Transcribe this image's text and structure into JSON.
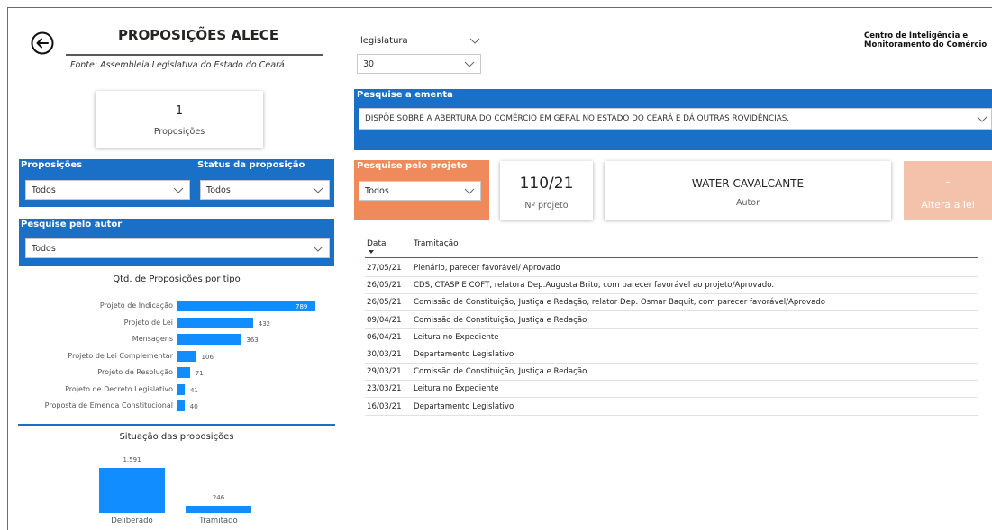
{
  "header": {
    "title": "PROPOSIÇÕES ALECE",
    "source": "Fonte: Assembleia Legislativa do Estado do Ceará"
  },
  "brand": {
    "line1": "Centro de Inteligência e",
    "line2": "Monitoramento do Comércio"
  },
  "count_card": {
    "value": "1",
    "label": "Proposições"
  },
  "filters": {
    "proposicoes": {
      "label": "Proposições",
      "value": "Todos"
    },
    "status": {
      "label": "Status da proposição",
      "value": "Todos"
    },
    "autor": {
      "label": "Pesquise pelo autor",
      "value": "Todos"
    },
    "legislatura": {
      "label": "legislatura",
      "value": "30"
    },
    "ementa": {
      "label": "Pesquise a ementa",
      "value": "DISPÕE SOBRE A ABERTURA DO COMÉRCIO EM GERAL NO ESTADO DO CEARÁ E DÁ OUTRAS ROVIDÊNCIAS."
    },
    "projeto": {
      "label": "Pesquise pelo projeto",
      "value": "Todos"
    }
  },
  "cards": {
    "projeto": {
      "value": "110/21",
      "label": "Nº projeto"
    },
    "autor": {
      "value": "WATER CAVALCANTE",
      "label": "Autor"
    },
    "altera": {
      "value": "-",
      "label": "Altera a lei"
    }
  },
  "chart_data": [
    {
      "type": "bar",
      "orientation": "horizontal",
      "title": "Qtd. de Proposições por tipo",
      "categories": [
        "Projeto de Indicação",
        "Projeto de Lei",
        "Mensagens",
        "Projeto de Lei Complementar",
        "Projeto de Resolução",
        "Projeto de Decreto Legislativo",
        "Proposta de Emenda Constitucional"
      ],
      "values": [
        789,
        432,
        363,
        106,
        71,
        41,
        40
      ],
      "value_labels": [
        "789",
        "432",
        "363",
        "106",
        "71",
        "41",
        "40"
      ],
      "color": "#118dff"
    },
    {
      "type": "bar",
      "title": "Situação das proposições",
      "categories": [
        "Deliberado",
        "Tramitado"
      ],
      "values": [
        1591,
        246
      ],
      "value_labels": [
        "1.591",
        "246"
      ],
      "color": "#118dff"
    }
  ],
  "table": {
    "headers": {
      "date": "Data",
      "text": "Tramitação"
    },
    "rows": [
      {
        "date": "27/05/21",
        "text": "Plenário, parecer favorável/ Aprovado"
      },
      {
        "date": "26/05/21",
        "text": "CDS, CTASP E COFT, relatora Dep.Augusta Brito, com parecer favorável ao projeto/Aprovado."
      },
      {
        "date": "26/05/21",
        "text": "Comissão de Constituição, Justiça e Redação, relator Dep. Osmar Baquit, com parecer favorável/Aprovado"
      },
      {
        "date": "09/04/21",
        "text": "Comissão de Constituição, Justiça e Redação"
      },
      {
        "date": "06/04/21",
        "text": "Leitura no Expediente"
      },
      {
        "date": "30/03/21",
        "text": "Departamento Legislativo"
      },
      {
        "date": "29/03/21",
        "text": "Comissão de Constituição, Justiça e Redação"
      },
      {
        "date": "23/03/21",
        "text": "Leitura no Expediente"
      },
      {
        "date": "16/03/21",
        "text": "Departamento Legislativo"
      }
    ]
  },
  "colors": {
    "panel": "#1a6fc7",
    "orange_panel": "#ee8a5c",
    "salmon_card": "#f4c1aa",
    "bar": "#118dff"
  }
}
